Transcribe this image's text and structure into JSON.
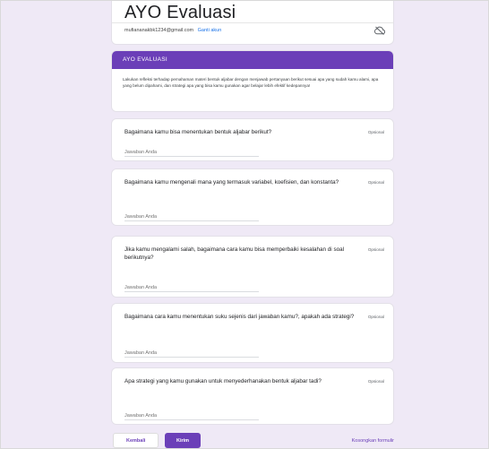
{
  "header": {
    "title": "AYO Evaluasi",
    "account_email": "mufiananakbk1234@gmail.com",
    "switch_account": "Ganti akun",
    "cloud_icon": "cloud-off-icon"
  },
  "section": {
    "title": "AYO EVALUASI",
    "description": "Lakukan refleksi terhadap pemahaman materi bentuk aljabar dengan menjawab pertanyaan berikut sesuai apa yang sudah kamu alami, apa yang belum dipahami, dan strategi apa yang bisa kamu gunakan agar belajar lebih efektif kedepannya!"
  },
  "questions": [
    {
      "text": "Bagaimana kamu bisa menentukan bentuk aljabar berikut?",
      "optional": "Opsional",
      "placeholder": "Jawaban Anda"
    },
    {
      "text": "Bagaimana kamu mengenali mana yang termasuk variabel, koefisien, dan konstanta?",
      "optional": "Opsional",
      "placeholder": "Jawaban Anda"
    },
    {
      "text": "Jika kamu mengalami salah, bagaimana cara kamu bisa memperbaiki kesalahan di soal berikutnya?",
      "optional": "Opsional",
      "placeholder": "Jawaban Anda"
    },
    {
      "text": "Bagaimana cara kamu menentukan suku sejenis dari jawaban kamu?, apakah ada strategi?",
      "optional": "Opsional",
      "placeholder": "Jawaban Anda"
    },
    {
      "text": "Apa strategi yang kamu gunakan untuk menyederhanakan bentuk aljabar tadi?",
      "optional": "Opsional",
      "placeholder": "Jawaban Anda"
    }
  ],
  "footer": {
    "back_label": "Kembali",
    "next_label": "Kirim",
    "clear_label": "Kosongkan formulir"
  },
  "colors": {
    "accent": "#6b3fb8",
    "background": "#efe9f6"
  }
}
